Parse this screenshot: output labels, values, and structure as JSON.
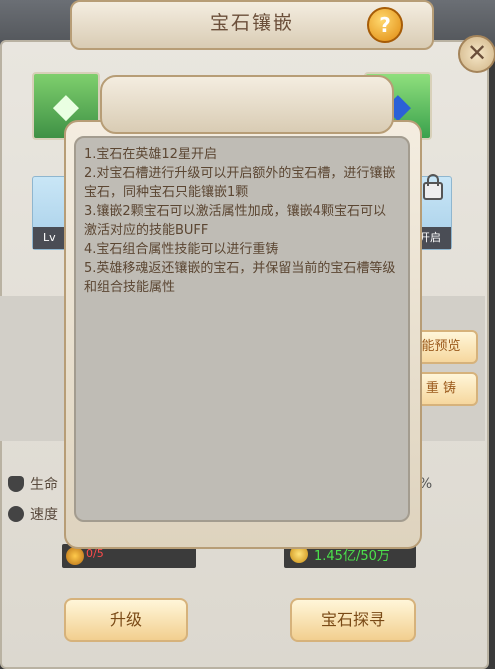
{
  "header": {
    "title": "宝石镶嵌",
    "help_label": "?"
  },
  "close": {
    "label": "✕"
  },
  "slots": {
    "left_level": "Lv",
    "right_status": "开启",
    "left_gem_icon": "gem-green",
    "right_gem_icon": "gem-blue"
  },
  "side_buttons": [
    {
      "label": "能预览"
    },
    {
      "label": "重 铸"
    }
  ],
  "attributes": [
    {
      "label": "生命",
      "icon": "shield-icon"
    },
    {
      "label": "速度",
      "icon": "speed-icon"
    }
  ],
  "attr_percent": "1%",
  "bar_left": {
    "value": "0/5"
  },
  "gold": {
    "text": "1.45亿/50万"
  },
  "buttons": {
    "upgrade": "升级",
    "search": "宝石探寻"
  },
  "popup": {
    "tips": [
      "1.宝石在英雄12星开启",
      "2.对宝石槽进行升级可以开启额外的宝石槽，进行镶嵌宝石，同种宝石只能镶嵌1颗",
      "3.镶嵌2颗宝石可以激活属性加成，镶嵌4颗宝石可以激活对应的技能BUFF",
      "4.宝石组合属性技能可以进行重铸",
      "5.英雄移魂返还镶嵌的宝石，并保留当前的宝石槽等级和组合技能属性"
    ]
  }
}
